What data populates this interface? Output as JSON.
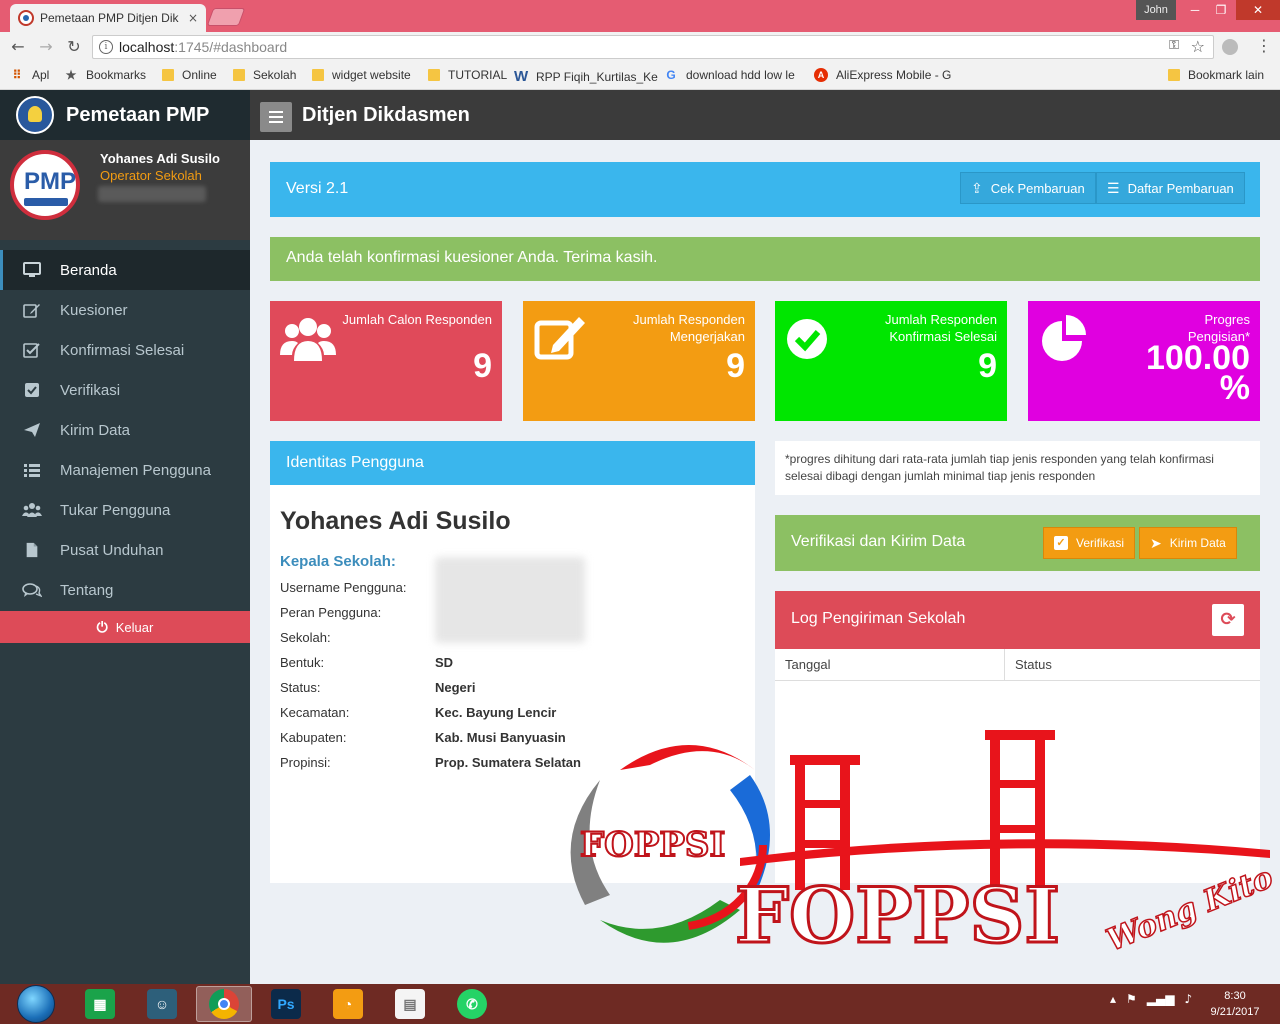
{
  "browser": {
    "tab_title": "Pemetaan PMP Ditjen Dik",
    "tab_close": "×",
    "user_chip": "John",
    "win_min": "─",
    "win_max": "❐",
    "win_close": "✕",
    "url_host": "localhost",
    "url_path": ":1745/#dashboard",
    "bookmarks": [
      {
        "label": "Apl",
        "icon": "apps-icon"
      },
      {
        "label": "Bookmarks",
        "icon": "star-icon"
      },
      {
        "label": "Online",
        "icon": "folder-icon"
      },
      {
        "label": "Sekolah",
        "icon": "folder-icon"
      },
      {
        "label": "widget website",
        "icon": "folder-icon"
      },
      {
        "label": "TUTORIAL",
        "icon": "folder-icon"
      },
      {
        "label": "RPP Fiqih_Kurtilas_Ke",
        "icon": "word-icon"
      },
      {
        "label": "download hdd low le",
        "icon": "google-icon"
      },
      {
        "label": "AliExpress Mobile - G",
        "icon": "aliexpress-icon"
      },
      {
        "label": "Bookmark lain",
        "icon": "folder-icon"
      }
    ]
  },
  "sidebar": {
    "brand": "Pemetaan PMP",
    "avatar_text": "PMP",
    "user_name": "Yohanes Adi Susilo",
    "user_role": "Operator Sekolah",
    "items": [
      {
        "label": "Beranda",
        "icon": "monitor-icon",
        "active": true
      },
      {
        "label": "Kuesioner",
        "icon": "edit-icon"
      },
      {
        "label": "Konfirmasi Selesai",
        "icon": "check-square-icon"
      },
      {
        "label": "Verifikasi",
        "icon": "checkbox-icon"
      },
      {
        "label": "Kirim Data",
        "icon": "paper-plane-icon"
      },
      {
        "label": "Manajemen Pengguna",
        "icon": "list-icon"
      },
      {
        "label": "Tukar Pengguna",
        "icon": "users-icon"
      },
      {
        "label": "Pusat Unduhan",
        "icon": "file-icon"
      },
      {
        "label": "Tentang",
        "icon": "comments-icon"
      }
    ],
    "logout": "Keluar"
  },
  "header": {
    "title": "Ditjen Dikdasmen"
  },
  "version": {
    "text": "Versi 2.1",
    "check_update": "Cek Pembaruan",
    "update_list": "Daftar Pembaruan"
  },
  "confirmation": "Anda telah konfirmasi kuesioner Anda. Terima kasih.",
  "stats": [
    {
      "label": "Jumlah Calon Responden",
      "value": "9",
      "color": "#e04a5a",
      "icon": "users-icon"
    },
    {
      "label": "Jumlah Responden Mengerjakan",
      "value": "9",
      "color": "#f39c12",
      "icon": "edit-icon"
    },
    {
      "label": "Jumlah Responden Konfirmasi Selesai",
      "value": "9",
      "color": "#00e600",
      "icon": "check-circle-icon"
    },
    {
      "label": "Progres Pengisian*",
      "value": "100.00 %",
      "color": "#e000e0",
      "icon": "pie-chart-icon"
    }
  ],
  "identity": {
    "title": "Identitas Pengguna",
    "name": "Yohanes Adi Susilo",
    "position": "Kepala Sekolah:",
    "rows": [
      {
        "label": "Username Pengguna:",
        "value": ""
      },
      {
        "label": "Peran Pengguna:",
        "value": ""
      },
      {
        "label": "Sekolah:",
        "value": ""
      },
      {
        "label": "Bentuk:",
        "value": "SD"
      },
      {
        "label": "Status:",
        "value": "Negeri"
      },
      {
        "label": "Kecamatan:",
        "value": "Kec. Bayung Lencir"
      },
      {
        "label": "Kabupaten:",
        "value": "Kab. Musi Banyuasin"
      },
      {
        "label": "Propinsi:",
        "value": "Prop. Sumatera Selatan"
      }
    ]
  },
  "note": "*progres dihitung dari rata-rata jumlah tiap jenis responden yang telah konfirmasi selesai dibagi dengan jumlah minimal tiap jenis responden",
  "verify": {
    "title": "Verifikasi dan Kirim Data",
    "verify_label": "Verifikasi",
    "send_label": "Kirim Data"
  },
  "log": {
    "title": "Log Pengiriman Sekolah",
    "columns": [
      "Tanggal",
      "Status"
    ]
  },
  "watermark": {
    "small": "FOPPSI",
    "big": "FOPPSI",
    "script": "Wong Kito"
  },
  "taskbar": {
    "apps": [
      "store-icon",
      "user-app-icon",
      "chrome-icon",
      "photoshop-icon",
      "uc-browser-icon",
      "notepad-icon",
      "whatsapp-icon"
    ],
    "photoshop_label": "Ps",
    "time": "8:30",
    "date": "9/21/2017"
  }
}
